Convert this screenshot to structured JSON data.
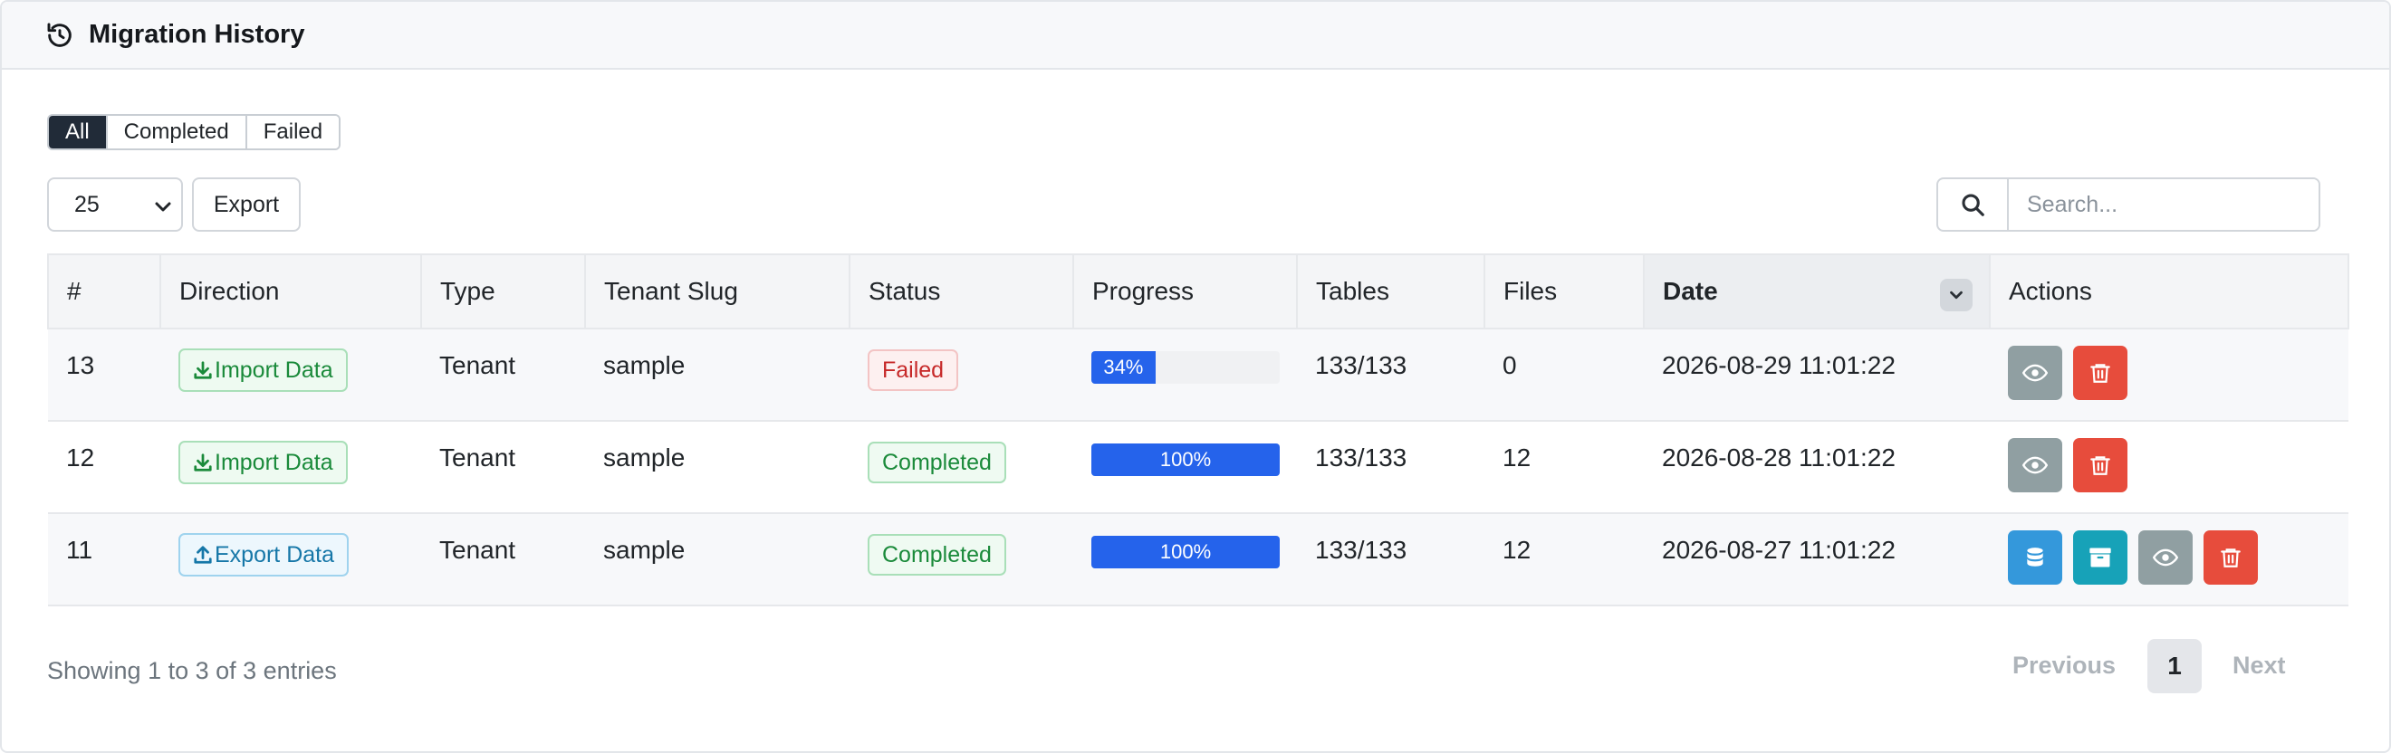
{
  "header": {
    "title": "Migration History",
    "icon": "history-icon"
  },
  "filters": [
    {
      "label": "All",
      "active": true
    },
    {
      "label": "Completed",
      "active": false
    },
    {
      "label": "Failed",
      "active": false
    }
  ],
  "toolbar": {
    "page_length": "25",
    "export_label": "Export",
    "search_placeholder": "Search..."
  },
  "table": {
    "columns": [
      "#",
      "Direction",
      "Type",
      "Tenant Slug",
      "Status",
      "Progress",
      "Tables",
      "Files",
      "Date",
      "Actions"
    ],
    "sorted_column": "Date",
    "rows": [
      {
        "id": "13",
        "direction": "Import Data",
        "direction_kind": "import",
        "type": "Tenant",
        "tenant_slug": "sample",
        "status": "Failed",
        "progress_label": "34%",
        "progress": 34,
        "tables": "133/133",
        "files": "0",
        "date": "2026-08-29 11:01:22",
        "actions": [
          "view",
          "delete"
        ]
      },
      {
        "id": "12",
        "direction": "Import Data",
        "direction_kind": "import",
        "type": "Tenant",
        "tenant_slug": "sample",
        "status": "Completed",
        "progress_label": "100%",
        "progress": 100,
        "tables": "133/133",
        "files": "12",
        "date": "2026-08-28 11:01:22",
        "actions": [
          "view",
          "delete"
        ]
      },
      {
        "id": "11",
        "direction": "Export Data",
        "direction_kind": "export",
        "type": "Tenant",
        "tenant_slug": "sample",
        "status": "Completed",
        "progress_label": "100%",
        "progress": 100,
        "tables": "133/133",
        "files": "12",
        "date": "2026-08-27 11:01:22",
        "actions": [
          "database",
          "archive",
          "view",
          "delete"
        ]
      }
    ]
  },
  "footer": {
    "info": "Showing 1 to 3 of 3 entries",
    "previous_label": "Previous",
    "current_page": "1",
    "next_label": "Next"
  },
  "colors": {
    "primary": "#2563eb",
    "danger": "#e74c3c",
    "success": "#1a8a3a",
    "info": "#17a2b8",
    "secondary": "#909fa2",
    "dark": "#212b38"
  }
}
